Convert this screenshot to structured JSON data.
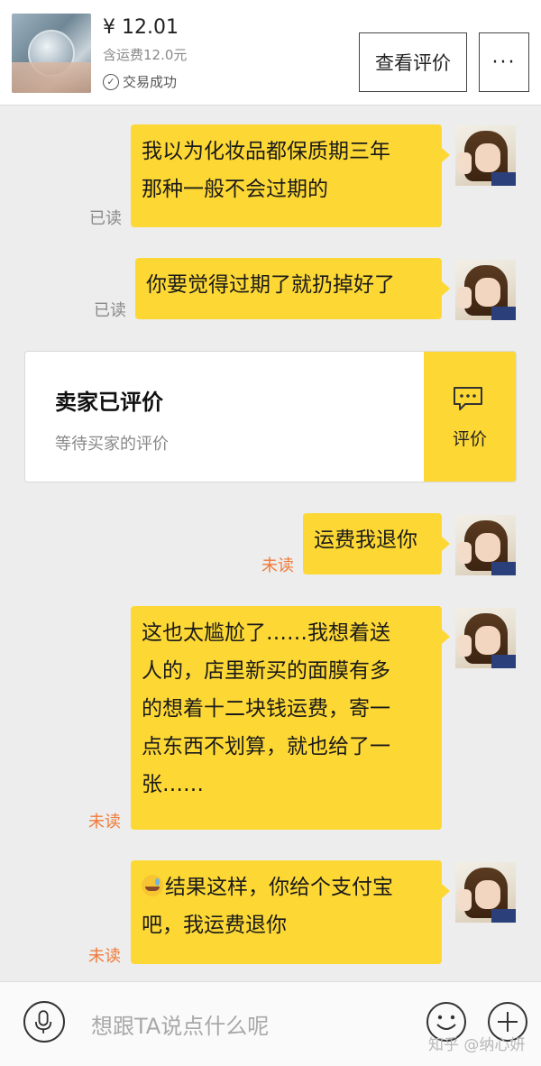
{
  "header": {
    "price": "¥ 12.01",
    "shipping": "含运费12.0元",
    "status": "交易成功",
    "view_review_label": "查看评价",
    "more_label": "···"
  },
  "messages": [
    {
      "lines": [
        "我以为化妆品都保质期三年",
        "那种一般不会过期的"
      ],
      "read_status": "已读"
    },
    {
      "lines": [
        "你要觉得过期了就扔掉好了"
      ],
      "read_status": "已读"
    },
    {
      "lines": [
        "运费我退你"
      ],
      "read_status": "未读"
    },
    {
      "lines": [
        "这也太尴尬了……我想着送",
        "人的，店里新买的面膜有多",
        "的想着十二块钱运费，寄一",
        "点东西不划算，就也给了一",
        "张……"
      ],
      "read_status": "未读"
    },
    {
      "lines": [
        "结果这样，你给个支付宝",
        "吧，我运费退你"
      ],
      "read_status": "未读"
    }
  ],
  "review_card": {
    "title": "卖家已评价",
    "subtitle": "等待买家的评价",
    "action_label": "评价"
  },
  "input": {
    "placeholder": "想跟TA说点什么呢"
  },
  "watermark": "知乎 @纳心妍",
  "colors": {
    "bubble": "#fdd835",
    "unread": "#f07a3a",
    "read": "#8a8a8a"
  }
}
